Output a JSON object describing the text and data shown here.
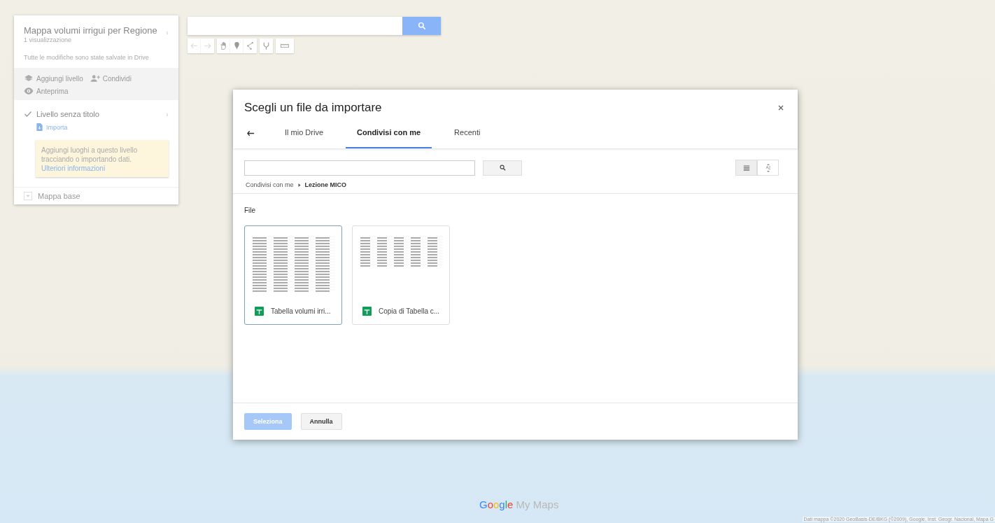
{
  "map": {
    "logo": {
      "brand": "Google",
      "product": "My Maps"
    },
    "attribution": "Dati mappa ©2020 GeoBasis-DE/BKG (©2009), Google, Inst. Geogr. Nacional, Mapa G"
  },
  "side_panel": {
    "title": "Mappa volumi irrigui per Regione",
    "views": "1 visualizzazione",
    "saved": "Tutte le modifiche sono state salvate in Drive",
    "actions": [
      {
        "kind": "layer",
        "label": "Aggiungi livello"
      },
      {
        "kind": "share",
        "label": "Condividi"
      },
      {
        "kind": "preview",
        "label": "Anteprima"
      }
    ],
    "layer": {
      "title": "Livello senza titolo",
      "checked": true,
      "import": "Importa",
      "tip": "Aggiungi luoghi a questo livello tracciando o importando dati.",
      "tip_link": "Ulteriori informazioni"
    },
    "base_map": {
      "label": "Mappa base",
      "expanded": false
    }
  },
  "toolbar": {
    "tools": [
      {
        "kind": "undo",
        "disabled": true
      },
      {
        "kind": "redo",
        "disabled": true
      },
      {
        "kind": "hand",
        "disabled": false
      },
      {
        "kind": "marker",
        "disabled": false
      },
      {
        "kind": "line",
        "disabled": false
      },
      {
        "kind": "route",
        "disabled": false
      },
      {
        "kind": "ruler",
        "disabled": false
      }
    ]
  },
  "dialog": {
    "title": "Scegli un file da importare",
    "tabs": [
      {
        "label": "Il mio Drive",
        "selected": false
      },
      {
        "label": "Condivisi con me",
        "selected": true
      },
      {
        "label": "Recenti",
        "selected": false
      }
    ],
    "breadcrumb": [
      {
        "label": "Condivisi con me",
        "current": false
      },
      {
        "label": "Lezione MICO",
        "current": true
      }
    ],
    "section": "File",
    "files": [
      {
        "name": "Tabella volumi irri...",
        "selected": true,
        "kind": "wide"
      },
      {
        "name": "Copia di Tabella c...",
        "selected": false,
        "kind": "short"
      }
    ],
    "buttons": [
      {
        "label": "Seleziona",
        "kind": "primary",
        "disabled": true
      },
      {
        "label": "Annulla",
        "kind": "secondary",
        "disabled": false
      }
    ]
  }
}
